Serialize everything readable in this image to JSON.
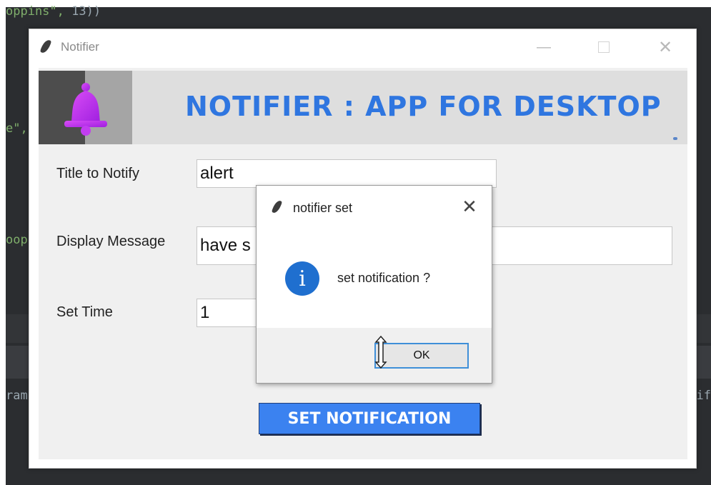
{
  "editor": {
    "code_top_prefix": "oppins\", ",
    "code_top_suffix": "13))",
    "code_line_1": "e\",",
    "code_line_2": "oop",
    "code_line_3": "ram",
    "code_line_3_right": "if"
  },
  "window": {
    "title": "Notifier",
    "icon": "feather-icon",
    "controls": [
      "minimize-icon",
      "maximize-icon",
      "close-icon"
    ]
  },
  "banner": {
    "icon": "bell-icon",
    "title": "NOTIFIER : APP FOR DESKTOP",
    "bell_color": "#c03cf0",
    "title_color": "#2f76e0"
  },
  "form": {
    "title_label": "Title to Notify",
    "title_value": "alert",
    "message_label": "Display Message",
    "message_value": "have s",
    "time_label": "Set Time",
    "time_value": "1",
    "submit_label": "SET NOTIFICATION",
    "submit_color": "#3b82f0"
  },
  "dialog": {
    "title": "notifier set",
    "icon": "info-icon",
    "icon_glyph": "i",
    "message": "set notification ?",
    "ok_label": "OK"
  }
}
